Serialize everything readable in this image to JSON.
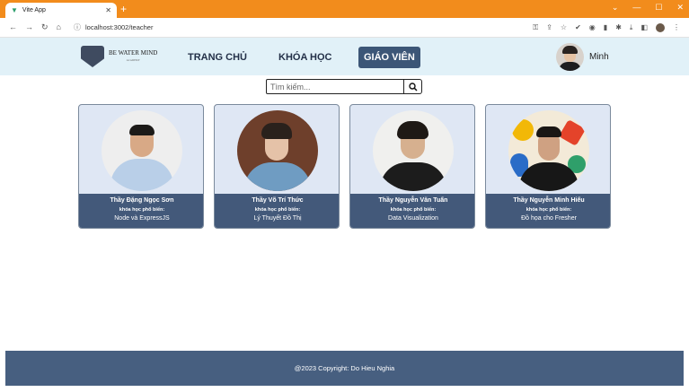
{
  "browser": {
    "tab_title": "Vite App",
    "url": "localhost:3002/teacher"
  },
  "header": {
    "brand": "BE WATER MIND",
    "brand_sub": "ACADEMY",
    "menu": {
      "home": "TRANG CHỦ",
      "courses": "KHÓA HỌC",
      "teachers": "GIÁO VIÊN"
    },
    "user_name": "Minh"
  },
  "search": {
    "placeholder": "Tìm kiếm..."
  },
  "teachers": [
    {
      "name": "Thầy Đặng Ngọc Sơn",
      "label": "khóa học phổ biến:",
      "course": "Node và ExpressJS"
    },
    {
      "name": "Thầy Võ Trí Thức",
      "label": "khóa học phổ biến:",
      "course": "Lý Thuyết Đồ Thị"
    },
    {
      "name": "Thầy Nguyễn Văn Tuấn",
      "label": "khóa học phổ biến:",
      "course": "Data Visualization"
    },
    {
      "name": "Thầy Nguyễn Minh Hiếu",
      "label": "khóa học phổ biến:",
      "course": "Đồ họa cho Fresher"
    }
  ],
  "footer": {
    "copyright": "@2023 Copyright: Do Hieu Nghia"
  }
}
